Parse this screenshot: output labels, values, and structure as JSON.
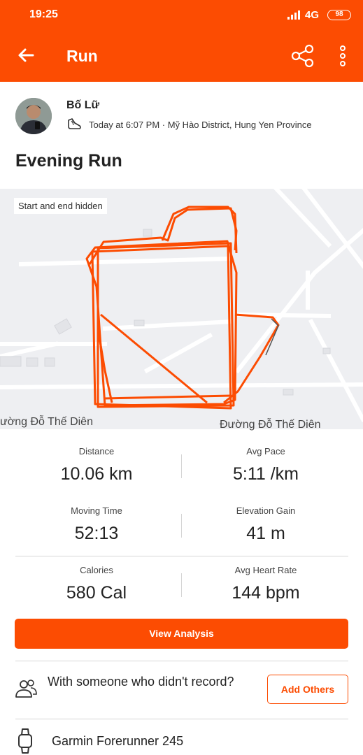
{
  "status_bar": {
    "time": "19:25",
    "network": "4G",
    "battery": "98"
  },
  "app_bar": {
    "title": "Run",
    "back_icon": "back-arrow-icon",
    "share_icon": "share-icon",
    "more_icon": "more-vertical-icon"
  },
  "header": {
    "athlete_name": "Bố Lữ",
    "meta": "Today at 6:07 PM · Mỹ Hào District, Hung Yen Province",
    "activity_icon": "shoe-icon"
  },
  "activity_title": "Evening Run",
  "map": {
    "note": "Start and end hidden",
    "road_label_left": "ường Đỗ Thế Diên",
    "road_label_right": "Đường Đỗ Thế Diên",
    "route_color": "#fc4c02"
  },
  "stats": [
    {
      "label": "Distance",
      "value": "10.06 km"
    },
    {
      "label": "Avg Pace",
      "value": "5:11 /km"
    },
    {
      "label": "Moving Time",
      "value": "52:13"
    },
    {
      "label": "Elevation Gain",
      "value": "41 m"
    },
    {
      "label": "Calories",
      "value": "580 Cal"
    },
    {
      "label": "Avg Heart Rate",
      "value": "144 bpm"
    }
  ],
  "view_analysis_label": "View Analysis",
  "others": {
    "text": "With someone who didn't record?",
    "button_label": "Add Others",
    "icon": "people-icon"
  },
  "device": {
    "name": "Garmin Forerunner 245",
    "icon": "watch-icon"
  },
  "colors": {
    "accent": "#fc4c02",
    "map_bg": "#eeeff2"
  }
}
